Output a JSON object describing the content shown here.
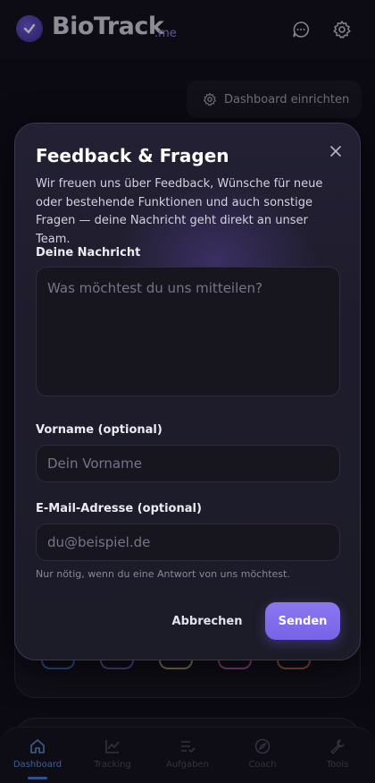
{
  "app": {
    "brand": "BioTrack",
    "brand_suffix": ".me",
    "dashboard_button": "Dashboard einrichten"
  },
  "modal": {
    "title": "Feedback & Fragen",
    "description": "Wir freuen uns über Feedback, Wünsche für neue oder bestehende Funktionen und auch sonstige Fragen — deine Nachricht geht direkt an unser Team.",
    "message_label": "Deine Nachricht",
    "message_placeholder": "Was möchtest du uns mitteilen?",
    "firstname_label": "Vorname (optional)",
    "firstname_placeholder": "Dein Vorname",
    "email_label": "E-Mail-Adresse (optional)",
    "email_placeholder": "du@beispiel.de",
    "email_hint": "Nur nötig, wenn du eine Antwort von uns möchtest.",
    "cancel_label": "Abbrechen",
    "send_label": "Senden"
  },
  "nav": {
    "items": [
      {
        "label": "Dashboard",
        "icon": "home-icon",
        "active": true
      },
      {
        "label": "Tracking",
        "icon": "chart-line-icon",
        "active": false
      },
      {
        "label": "Aufgaben",
        "icon": "task-list-icon",
        "active": false
      },
      {
        "label": "Coach",
        "icon": "compass-icon",
        "active": false
      },
      {
        "label": "Tools",
        "icon": "wrench-icon",
        "active": false
      }
    ]
  },
  "colors": {
    "accent": "#7b67ea",
    "nav_active": "#5b8fd8",
    "background": "#0d0c14"
  }
}
